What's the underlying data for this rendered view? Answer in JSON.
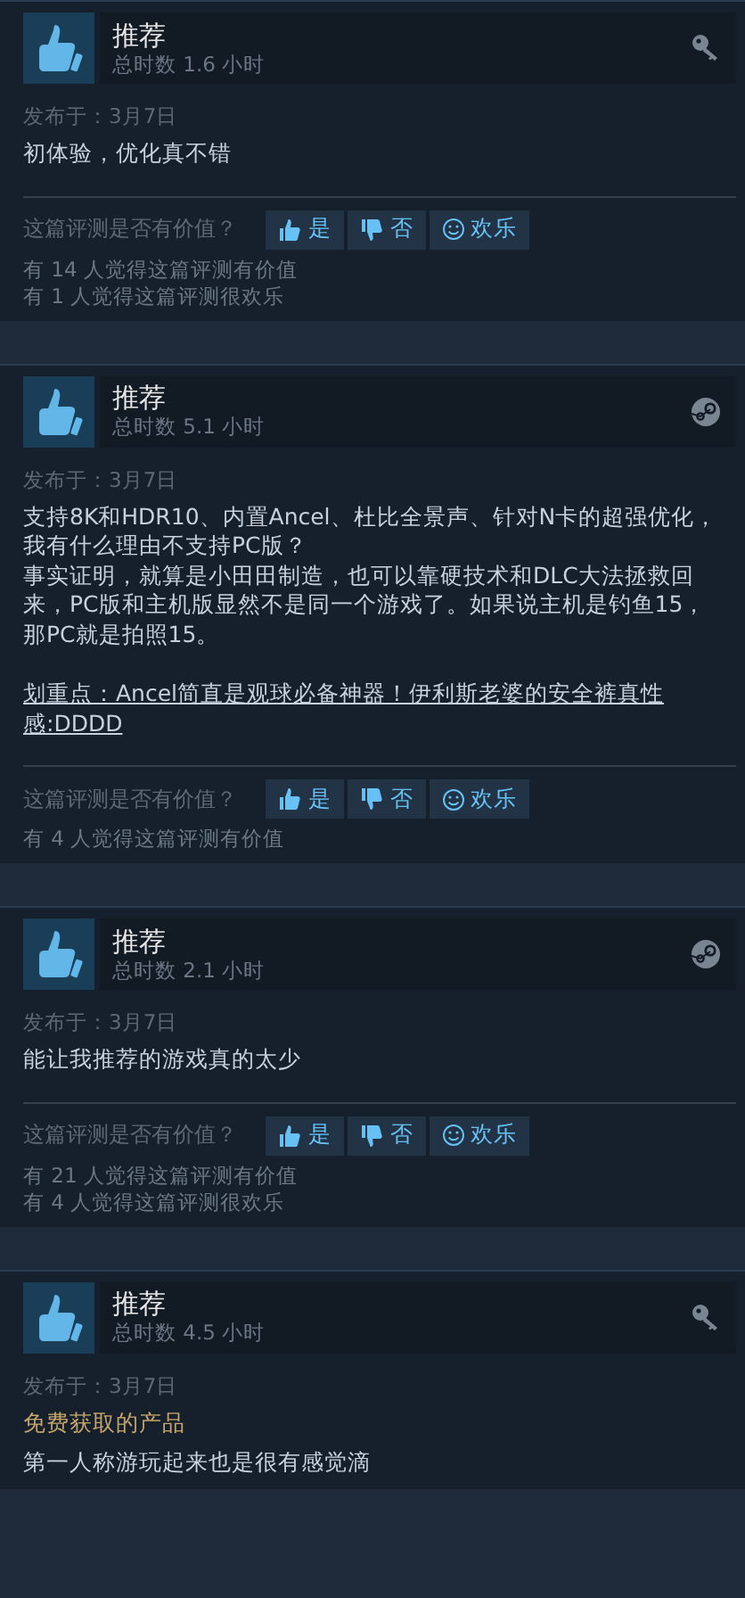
{
  "reviews": [
    {
      "verdict": "推荐",
      "hours": "总时数 1.6 小时",
      "kind": "key",
      "posted": "发布于：3月7日",
      "body": [
        {
          "kind": "text",
          "text": "初体验，优化真不错"
        }
      ],
      "question": "这篇评测是否有价值？",
      "buttons": [
        {
          "kind": "up",
          "label": "是"
        },
        {
          "kind": "down",
          "label": "否"
        },
        {
          "kind": "funny",
          "label": "欢乐"
        }
      ],
      "counts": [
        "有 14 人觉得这篇评测有价值",
        "有 1 人觉得这篇评测很欢乐"
      ]
    },
    {
      "verdict": "推荐",
      "hours": "总时数 5.1 小时",
      "kind": "steam",
      "posted": "发布于：3月7日",
      "body": [
        {
          "kind": "text",
          "text": "支持8K和HDR10、内置Ancel、杜比全景声、针对N卡的超强优化，我有什么理由不支持PC版？"
        },
        {
          "kind": "text",
          "text": "事实证明，就算是小田田制造，也可以靠硬技术和DLC大法拯救回来，PC版和主机版显然不是同一个游戏了。如果说主机是钓鱼15，那PC就是拍照15。"
        },
        {
          "kind": "link",
          "text": "划重点：Ancel简直是观球必备神器！伊利斯老婆的安全裤真性感:DDDD"
        }
      ],
      "question": "这篇评测是否有价值？",
      "buttons": [
        {
          "kind": "up",
          "label": "是"
        },
        {
          "kind": "down",
          "label": "否"
        },
        {
          "kind": "funny",
          "label": "欢乐"
        }
      ],
      "counts": [
        "有 4 人觉得这篇评测有价值"
      ]
    },
    {
      "verdict": "推荐",
      "hours": "总时数 2.1 小时",
      "kind": "steam",
      "posted": "发布于：3月7日",
      "body": [
        {
          "kind": "text",
          "text": "能让我推荐的游戏真的太少"
        }
      ],
      "question": "这篇评测是否有价值？",
      "buttons": [
        {
          "kind": "up",
          "label": "是"
        },
        {
          "kind": "down",
          "label": "否"
        },
        {
          "kind": "funny",
          "label": "欢乐"
        }
      ],
      "counts": [
        "有 21 人觉得这篇评测有价值",
        "有 4 人觉得这篇评测很欢乐"
      ]
    },
    {
      "verdict": "推荐",
      "hours": "总时数 4.5 小时",
      "kind": "key",
      "posted": "发布于：3月7日",
      "body": [
        {
          "kind": "notice",
          "text": "免费获取的产品"
        },
        {
          "kind": "text",
          "text": "第一人称游玩起来也是很有感觉滴"
        }
      ]
    }
  ]
}
